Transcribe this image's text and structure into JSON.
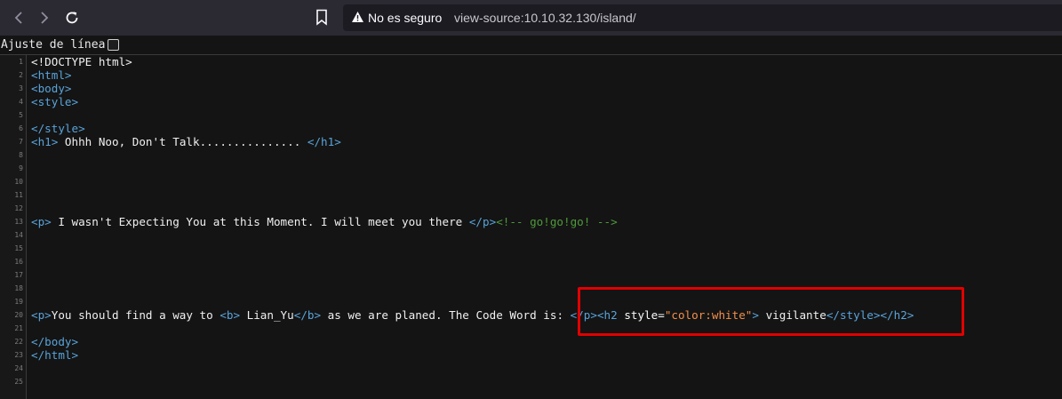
{
  "browser": {
    "security_text": "No es seguro",
    "url": "view-source:10.10.32.130/island/"
  },
  "wrap_toggle": {
    "label": "Ajuste de línea",
    "checked": false
  },
  "line_numbers": [
    "1",
    "2",
    "3",
    "4",
    "5",
    "6",
    "7",
    "8",
    "9",
    "10",
    "11",
    "12",
    "13",
    "14",
    "15",
    "16",
    "17",
    "18",
    "19",
    "20",
    "21",
    "22",
    "23",
    "24",
    "25"
  ],
  "source": {
    "l1": "<!DOCTYPE html>",
    "l2": "<html>",
    "l3": "<body>",
    "l4": "<style>",
    "l6": "</style>",
    "l7_open": "<h1>",
    "l7_text": " Ohhh Noo, Don't Talk............... ",
    "l7_close": "</h1>",
    "l13_open": "<p>",
    "l13_text": " I wasn't Expecting You at this Moment. I will meet you there ",
    "l13_close": "</p>",
    "l13_comment": "<!-- go!go!go! -->",
    "l20_p": "<p>",
    "l20_t1": "You should find a way to ",
    "l20_b_open": "<b>",
    "l20_t2": " Lian_Yu",
    "l20_b_close": "</b>",
    "l20_t3": " as we are planed. The Code Word is: ",
    "l20_p_close": "</p>",
    "l20_h2_open": "<h2 ",
    "l20_attr": "style=",
    "l20_val": "\"color:white\"",
    "l20_gt": ">",
    "l20_t4": " vigilante",
    "l20_close": "</style></h2>",
    "l22": "</body>",
    "l23": "</html>"
  },
  "colors": {
    "tag": "#59a3d9",
    "attribute_value": "#f18f4d",
    "comment": "#4f9a3b",
    "highlight_box": "#e10000"
  }
}
